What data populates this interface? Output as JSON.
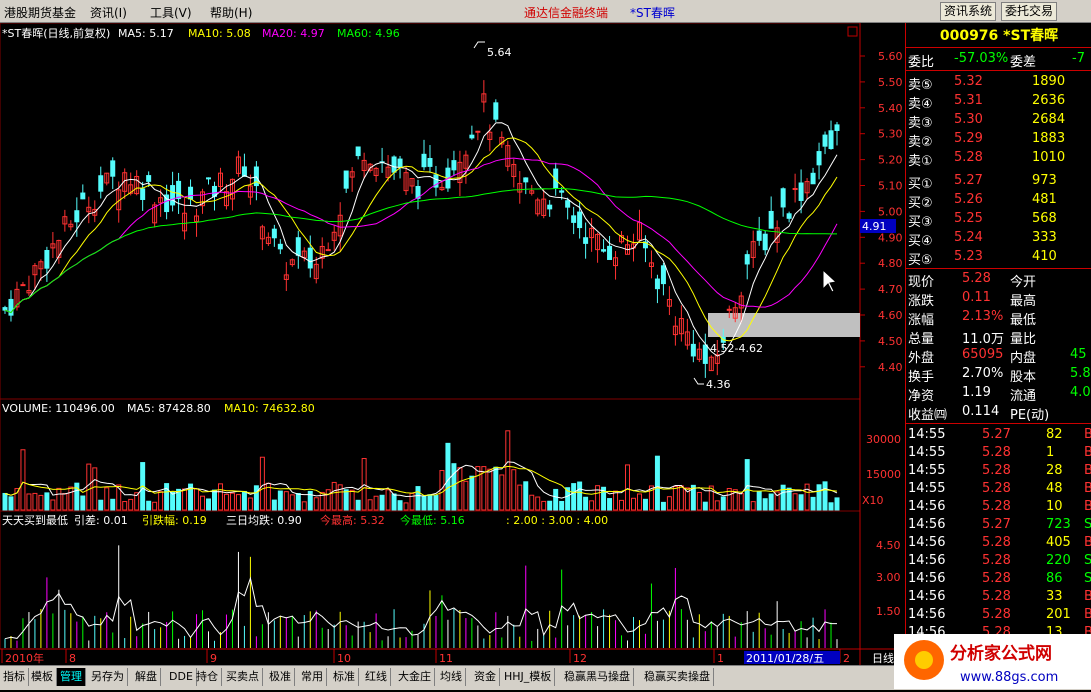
{
  "menu": [
    "港股期货基金",
    "资讯(I)",
    "工具(V)",
    "帮助(H)"
  ],
  "app_title": "通达信金融终端",
  "stock_title": "*ST春晖",
  "top_buttons": [
    "资讯系统",
    "委托交易"
  ],
  "kline_header": {
    "name": "*ST春晖(日线,前复权)",
    "ma5": "MA5: 5.17",
    "ma10": "MA10: 5.08",
    "ma20": "MA20: 4.97",
    "ma60": "MA60: 4.96"
  },
  "price_axis": [
    "5.60",
    "5.50",
    "5.40",
    "5.30",
    "5.20",
    "5.10",
    "5.00",
    "4.90",
    "4.80",
    "4.70",
    "4.60",
    "4.50",
    "4.40"
  ],
  "current_price_tag": "4.91",
  "annotations": {
    "high": "5.64",
    "low": "4.36",
    "range": "4.52-4.62"
  },
  "volume_header": {
    "vol": "VOLUME: 110496.00",
    "ma5": "MA5: 87428.80",
    "ma10": "MA10: 74632.80"
  },
  "volume_axis": [
    "30000",
    "15000"
  ],
  "volume_unit": "X10",
  "indicator_header": {
    "name": "天天买到最低",
    "diff": "引差: 0.01",
    "fall": "引跌幅: 0.19",
    "avg": "三日均跌: 0.90",
    "high": "今最高: 5.32",
    "low": "今最低: 5.16",
    "levels": ": 2.00 : 3.00 : 4.00"
  },
  "indicator_axis": [
    "4.50",
    "3.00",
    "1.50"
  ],
  "date_axis": [
    "2010年",
    "8",
    "9",
    "10",
    "11",
    "12",
    "1",
    "2011/01/28/五",
    "2"
  ],
  "date_axis_right": "日线",
  "quote": {
    "code": "000976",
    "name": "*ST春晖",
    "weibi_label": "委比",
    "weibi": "-57.03%",
    "weicha_label": "委差",
    "weicha": "-7",
    "sells": [
      {
        "label": "卖⑤",
        "price": "5.32",
        "vol": "1890"
      },
      {
        "label": "卖④",
        "price": "5.31",
        "vol": "2636"
      },
      {
        "label": "卖③",
        "price": "5.30",
        "vol": "2684"
      },
      {
        "label": "卖②",
        "price": "5.29",
        "vol": "1883"
      },
      {
        "label": "卖①",
        "price": "5.28",
        "vol": "1010"
      }
    ],
    "buys": [
      {
        "label": "买①",
        "price": "5.27",
        "vol": "973"
      },
      {
        "label": "买②",
        "price": "5.26",
        "vol": "481"
      },
      {
        "label": "买③",
        "price": "5.25",
        "vol": "568"
      },
      {
        "label": "买④",
        "price": "5.24",
        "vol": "333"
      },
      {
        "label": "买⑤",
        "price": "5.23",
        "vol": "410"
      }
    ],
    "stats": [
      {
        "l1": "现价",
        "v1": "5.28",
        "l2": "今开",
        "v2": ""
      },
      {
        "l1": "涨跌",
        "v1": "0.11",
        "l2": "最高",
        "v2": ""
      },
      {
        "l1": "涨幅",
        "v1": "2.13%",
        "l2": "最低",
        "v2": ""
      },
      {
        "l1": "总量",
        "v1": "11.0万",
        "l2": "量比",
        "v2": ""
      },
      {
        "l1": "外盘",
        "v1": "65095",
        "l2": "内盘",
        "v2": "45"
      },
      {
        "l1": "换手",
        "v1": "2.70%",
        "l2": "股本",
        "v2": "5.8"
      },
      {
        "l1": "净资",
        "v1": "1.19",
        "l2": "流通",
        "v2": "4.0"
      },
      {
        "l1": "收益㈣",
        "v1": "0.114",
        "l2": "PE(动)",
        "v2": ""
      }
    ],
    "ticks": [
      {
        "t": "14:55",
        "p": "5.27",
        "v": "82",
        "s": "B"
      },
      {
        "t": "14:55",
        "p": "5.28",
        "v": "1",
        "s": "B"
      },
      {
        "t": "14:55",
        "p": "5.28",
        "v": "28",
        "s": "B"
      },
      {
        "t": "14:55",
        "p": "5.28",
        "v": "48",
        "s": "B"
      },
      {
        "t": "14:56",
        "p": "5.28",
        "v": "10",
        "s": "B"
      },
      {
        "t": "14:56",
        "p": "5.27",
        "v": "723",
        "s": "S"
      },
      {
        "t": "14:56",
        "p": "5.28",
        "v": "405",
        "s": "B"
      },
      {
        "t": "14:56",
        "p": "5.28",
        "v": "220",
        "s": "S"
      },
      {
        "t": "14:56",
        "p": "5.28",
        "v": "86",
        "s": "S"
      },
      {
        "t": "14:56",
        "p": "5.28",
        "v": "33",
        "s": "B"
      },
      {
        "t": "14:56",
        "p": "5.28",
        "v": "201",
        "s": "B"
      },
      {
        "t": "14:56",
        "p": "5.28",
        "v": "13",
        "s": "B"
      }
    ]
  },
  "tabs": [
    "指标",
    "模板",
    "管理",
    "另存为",
    "解盘",
    "DDE",
    "持仓",
    "买卖点",
    "极准",
    "常用",
    "标准",
    "红线",
    "大金庄",
    "均线",
    "资金",
    "HHJ_模板",
    "稳赢黑马操盘",
    "稳赢买卖操盘"
  ],
  "active_tab": "管理",
  "logo": {
    "title": "分析家公式网",
    "url": "www.88gs.com"
  },
  "colors": {
    "up": "#ff3232",
    "down": "#54fcfc",
    "ma5": "#ffffff",
    "ma10": "#ffff00",
    "ma20": "#ff00ff",
    "ma60": "#00ff00",
    "grid": "#800000"
  }
}
